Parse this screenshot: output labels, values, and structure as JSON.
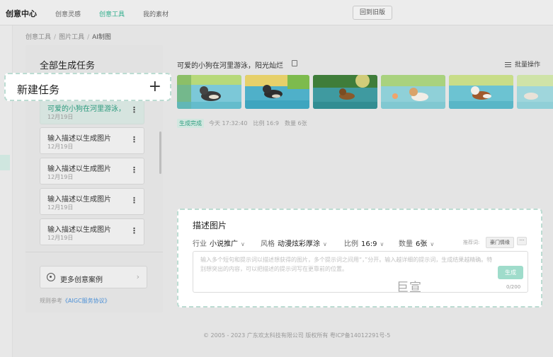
{
  "header": {
    "brand": "创意中心",
    "nav": [
      "创意灵感",
      "创意工具",
      "我的素材"
    ],
    "active_nav": "创意工具",
    "back_button": "回到旧版"
  },
  "breadcrumb": [
    "创意工具",
    "图片工具",
    "AI制图"
  ],
  "tasks": {
    "title": "全部生成任务",
    "new_task": "新建任务",
    "new_task_icon": "plus-icon",
    "items": [
      {
        "name": "可爱的小狗在河里游泳，阳光灿烂",
        "date": "12月19日",
        "active": true
      },
      {
        "name": "输入描述以生成图片",
        "date": "12月19日"
      },
      {
        "name": "输入描述以生成图片",
        "date": "12月19日"
      },
      {
        "name": "输入描述以生成图片",
        "date": "12月19日"
      },
      {
        "name": "输入描述以生成图片",
        "date": "12月19日"
      }
    ],
    "more_cases": "更多创意案例",
    "agreement_prefix": "规则参考",
    "agreement_link": "《AIGC服务协议》"
  },
  "result": {
    "prompt": "可爱的小狗在河里游泳，阳光灿烂",
    "batch_label": "批量操作",
    "status": "生成完成",
    "time": "今天 17:32:40",
    "ratio": "比例 16:9",
    "count": "数量 6张"
  },
  "describe": {
    "title": "描述图片",
    "industry_label": "行业",
    "industry_value": "小说推广",
    "style_label": "风格",
    "style_value": "动漫炫彩厚涂",
    "ratio_label": "比例",
    "ratio_value": "16:9",
    "count_label": "数量",
    "count_value": "6张",
    "recommend_label": "推荐词:",
    "recommend_chip": "豪门情缘",
    "recommend_more": "···",
    "placeholder": "输入多个短句和提示词以描述想获得的图片，多个提示词之间用“，”分开。输入越详细的提示词，生成结果越精确。特别想突出的内容，可以把描述的提示词写在更靠前的位置。",
    "generate": "生成",
    "char_count": "0/200",
    "watermark": "巨宣"
  },
  "footer": "© 2005 - 2023 广东欢太科技有限公司 版权所有 粤ICP备14012291号-5",
  "colors": {
    "accent": "#2fae8c",
    "highlight_border": "#bcdcd2",
    "generate_button": "#9fdccb"
  }
}
